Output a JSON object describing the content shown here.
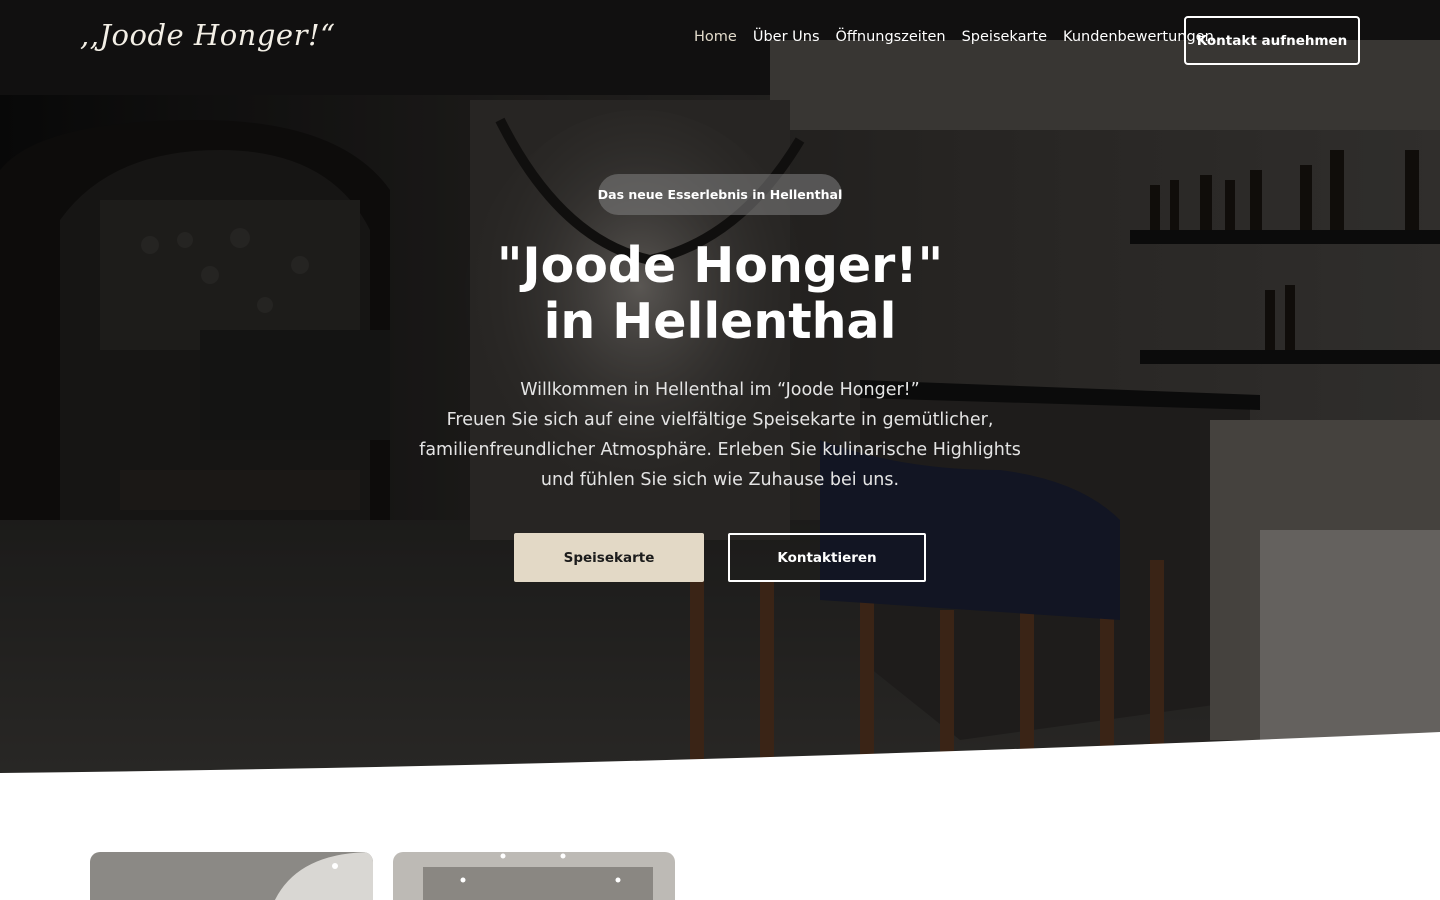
{
  "brand": {
    "logo_text": ",,Joode Honger!“"
  },
  "nav": {
    "items": [
      {
        "label": "Home",
        "active": true
      },
      {
        "label": "Über Uns"
      },
      {
        "label": "Öffnungszeiten"
      },
      {
        "label": "Speisekarte"
      },
      {
        "label": "Kundenbewertungen"
      }
    ],
    "cta_label": "Kontakt aufnehmen"
  },
  "hero": {
    "badge": "Das neue Esserlebnis in Hellenthal",
    "title_lines": [
      "\"Joode Honger!\"",
      "in Hellenthal"
    ],
    "intro_lines": [
      "Willkommen in Hellenthal im “Joode Honger!”",
      "Freuen Sie sich auf eine vielfältige Speisekarte in gemütlicher,",
      "familienfreundlicher Atmosphäre. Erleben Sie kulinarische Highlights",
      "und fühlen Sie sich wie Zuhause bei uns."
    ],
    "primary_button": "Speisekarte",
    "secondary_button": "Kontaktieren"
  },
  "colors": {
    "accent_beige": "#e3d9c6",
    "text_white": "#ffffff",
    "overlay_dark": "#161616"
  }
}
